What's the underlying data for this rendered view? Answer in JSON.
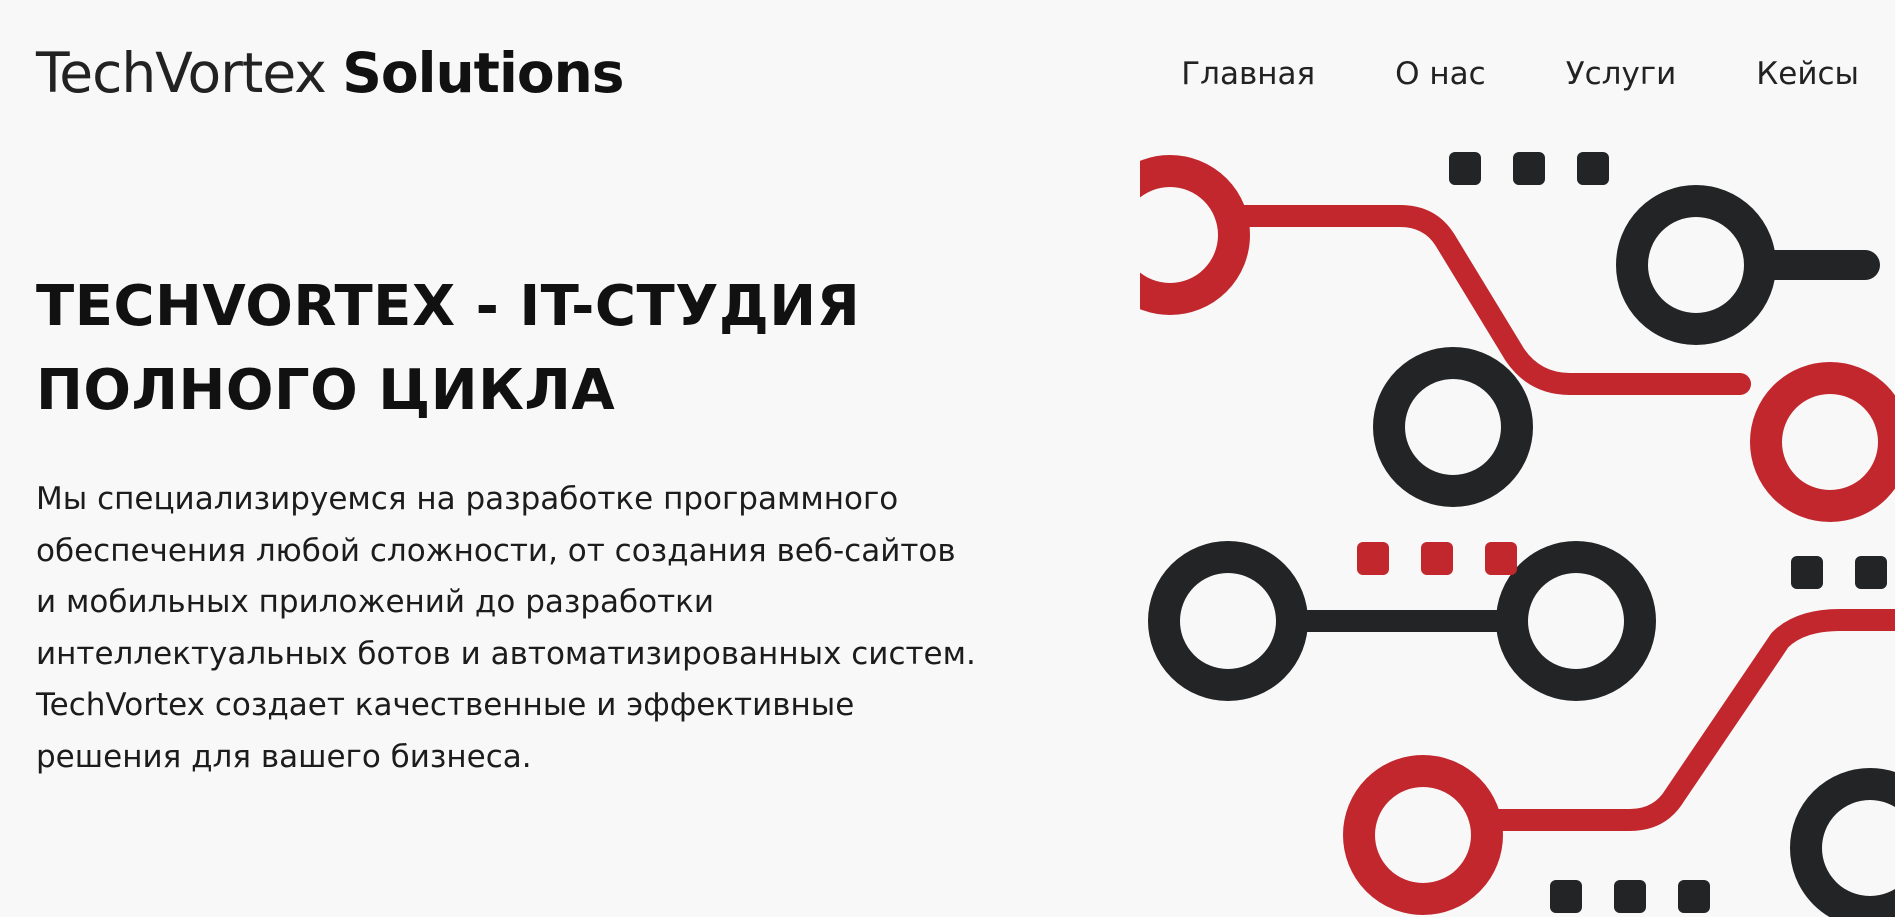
{
  "brand": {
    "name_light": "TechVortex",
    "name_bold": "Solutions"
  },
  "nav": {
    "items": [
      {
        "label": "Главная"
      },
      {
        "label": "О нас"
      },
      {
        "label": "Услуги"
      },
      {
        "label": "Кейсы"
      }
    ]
  },
  "hero": {
    "title": "TECHVORTEX - IT-СТУДИЯ ПОЛНОГО ЦИКЛА",
    "description": "Мы специализируемся на разработке программного обеспечения любой сложности, от создания веб-сайтов и мобильных приложений до разработки интеллектуальных ботов и автоматизированных систем. TechVortex создает качественные и эффективные решения для вашего бизнеса."
  },
  "illustration": {
    "name": "circuit-board-illustration",
    "colors": {
      "red": "#c1272d",
      "dark": "#222425"
    }
  }
}
